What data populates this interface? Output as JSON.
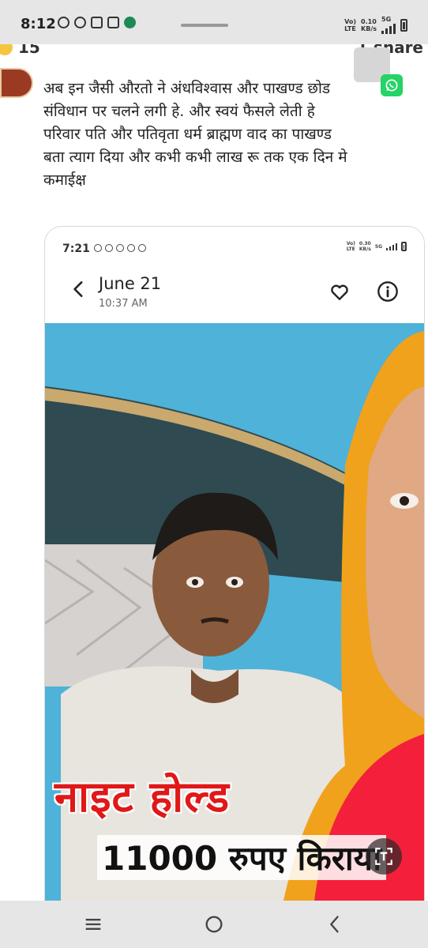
{
  "status_bar": {
    "time": "8:12",
    "network_line1": "Vo)",
    "network_line2": "LTE",
    "speed_value": "0.10",
    "speed_unit": "KB/s",
    "network_type": "5G"
  },
  "post": {
    "reaction_count": "15",
    "share_count": "1 share",
    "text_lines": [
      "अब इन जैसी औरतो ने अंधविश्वास और पाखण्ड छोड",
      "संविधान पर चलने लगी हे. और स्वयं फैसले लेती हे",
      "परिवार पति  और पतिवृता धर्म ब्राह्मण वाद का पाखण्ड",
      "बता त्याग दिया और कभी कभी लाख रू तक एक दिन मे",
      "कमाईक्ष"
    ]
  },
  "embedded_screenshot": {
    "status_time": "7:21",
    "status_net1": "Vo)",
    "status_net2": "LTE",
    "status_speed": "0.30",
    "status_unit": "KB/s",
    "status_type": "5G",
    "date": "June 21",
    "time": "10:37 AM",
    "overlay_red_text": "नाइट होल्ड",
    "overlay_black_text": "11000 रुपए किराया"
  },
  "icons": {
    "whatsapp": "whatsapp-icon",
    "heart": "heart-icon",
    "info": "info-icon",
    "back": "back-arrow-icon",
    "translate": "text-recognition-icon",
    "nav_recent": "recent-apps-icon",
    "nav_home": "home-icon",
    "nav_back": "back-icon"
  },
  "colors": {
    "whatsapp_green": "#25d366",
    "overlay_red": "#e01818",
    "sky_blue": "#4fb2d8"
  }
}
